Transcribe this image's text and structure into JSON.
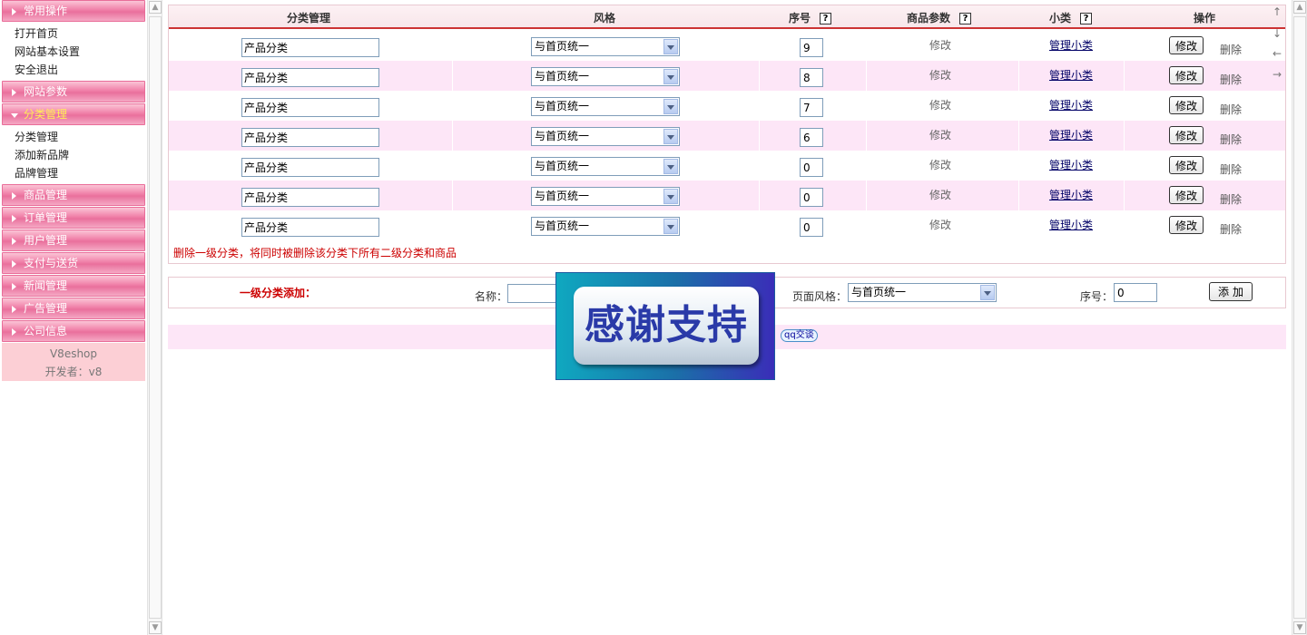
{
  "sidebar": {
    "sections": [
      {
        "label": "常用操作",
        "open": false,
        "items": [
          "打开首页",
          "网站基本设置",
          "安全退出"
        ]
      },
      {
        "label": "网站参数",
        "open": false,
        "items": []
      },
      {
        "label": "分类管理",
        "open": true,
        "items": [
          "分类管理",
          "添加新品牌",
          "品牌管理"
        ]
      },
      {
        "label": "商品管理",
        "open": false,
        "items": []
      },
      {
        "label": "订单管理",
        "open": false,
        "items": []
      },
      {
        "label": "用户管理",
        "open": false,
        "items": []
      },
      {
        "label": "支付与送货",
        "open": false,
        "items": []
      },
      {
        "label": "新闻管理",
        "open": false,
        "items": []
      },
      {
        "label": "广告管理",
        "open": false,
        "items": []
      },
      {
        "label": "公司信息",
        "open": false,
        "items": []
      }
    ],
    "footer_name": "V8eshop",
    "footer_dev": "开发者：v8"
  },
  "table": {
    "headers": {
      "category": "分类管理",
      "style": "风格",
      "order": "序号",
      "params": "商品参数",
      "subcat": "小类",
      "actions": "操作"
    },
    "help_glyph": "?",
    "rows": [
      {
        "name": "产品分类",
        "style": "与首页统一",
        "order": "9",
        "params": "修改",
        "subcat": "管理小类",
        "edit": "修改",
        "delete": "删除"
      },
      {
        "name": "产品分类",
        "style": "与首页统一",
        "order": "8",
        "params": "修改",
        "subcat": "管理小类",
        "edit": "修改",
        "delete": "删除"
      },
      {
        "name": "产品分类",
        "style": "与首页统一",
        "order": "7",
        "params": "修改",
        "subcat": "管理小类",
        "edit": "修改",
        "delete": "删除"
      },
      {
        "name": "产品分类",
        "style": "与首页统一",
        "order": "6",
        "params": "修改",
        "subcat": "管理小类",
        "edit": "修改",
        "delete": "删除"
      },
      {
        "name": "产品分类",
        "style": "与首页统一",
        "order": "0",
        "params": "修改",
        "subcat": "管理小类",
        "edit": "修改",
        "delete": "删除"
      },
      {
        "name": "产品分类",
        "style": "与首页统一",
        "order": "0",
        "params": "修改",
        "subcat": "管理小类",
        "edit": "修改",
        "delete": "删除"
      },
      {
        "name": "产品分类",
        "style": "与首页统一",
        "order": "0",
        "params": "修改",
        "subcat": "管理小类",
        "edit": "修改",
        "delete": "删除"
      }
    ],
    "warning": "删除一级分类，将同时被删除该分类下所有二级分类和商品"
  },
  "add_form": {
    "title": "一级分类添加：",
    "name_label": "名称：",
    "name_value": "",
    "style_label": "页面风格：",
    "style_value": "与首页统一",
    "order_label": "序号：",
    "order_value": "0",
    "button": "添加"
  },
  "footer": {
    "qq_label": "qq交谈"
  },
  "popup": {
    "text": "感谢支持"
  },
  "nav_arrows": [
    "↑",
    "↓",
    "←",
    "→"
  ],
  "colors": {
    "accent_pink": "#f07fa8",
    "alt_row": "#fde6f7",
    "warning_red": "#cc0000",
    "header_rule": "#cc3333"
  }
}
